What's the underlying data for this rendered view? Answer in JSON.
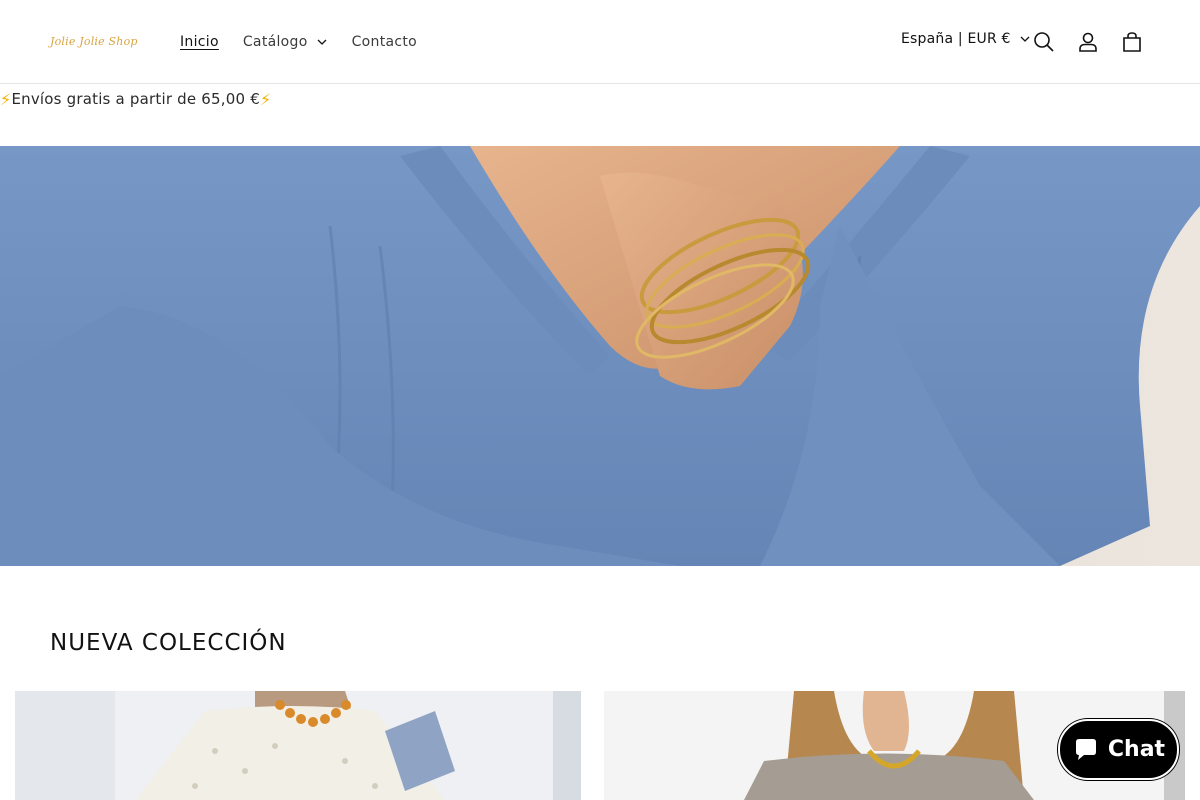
{
  "header": {
    "logo_text": "Jolie Jolie Shop",
    "nav": [
      {
        "label": "Inicio",
        "active": true
      },
      {
        "label": "Catálogo",
        "has_dropdown": true
      },
      {
        "label": "Contacto"
      }
    ],
    "country_selector": "España | EUR €",
    "icons": [
      "search-icon",
      "account-icon",
      "cart-icon"
    ]
  },
  "announcement": {
    "text": "Envíos gratis a partir de 65,00 €",
    "prefix_icon": "⚡",
    "suffix_icon": "⚡"
  },
  "section": {
    "title": "NUEVA COLECCIÓN"
  },
  "chat": {
    "label": "Chat"
  },
  "colors": {
    "accent_logo": "#d9a441",
    "bolt": "#f2b200",
    "shirt_blue": "#6f8fbf",
    "chat_bg": "#000000"
  }
}
